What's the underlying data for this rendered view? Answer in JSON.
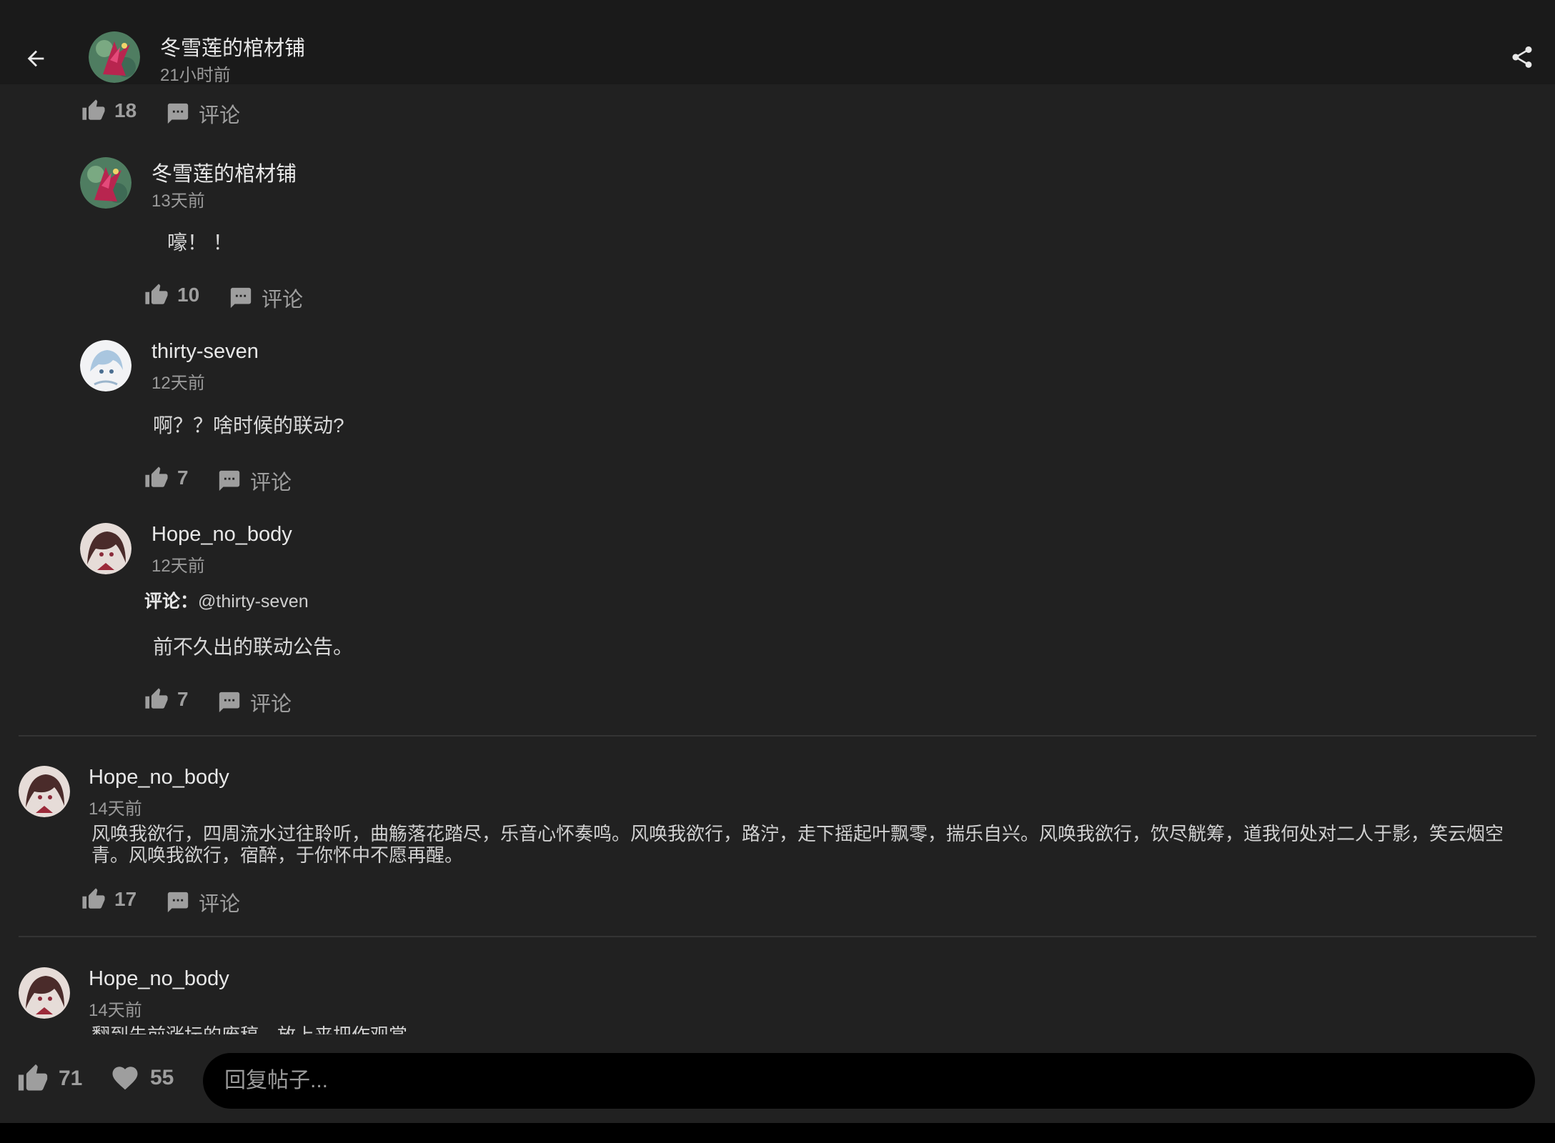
{
  "header": {
    "author": "冬雪莲的棺材铺",
    "time": "21小时前"
  },
  "post_actions": {
    "likes": "18",
    "comment_label": "评论"
  },
  "replies": [
    {
      "user": "冬雪莲的棺材铺",
      "time": "13天前",
      "text": "嚎！ ！",
      "likes": "10",
      "comment_label": "评论"
    },
    {
      "user": "thirty-seven",
      "time": "12天前",
      "text": "啊？？啥时候的联动?",
      "likes": "7",
      "comment_label": "评论"
    },
    {
      "user": "Hope_no_body",
      "time": "12天前",
      "reply_prefix": "评论：",
      "reply_to": "@thirty-seven",
      "text": "前不久出的联动公告。",
      "likes": "7",
      "comment_label": "评论"
    }
  ],
  "posts": [
    {
      "user": "Hope_no_body",
      "time": "14天前",
      "text": "风唤我欲行，四周流水过往聆听，曲觞落花踏尽，乐音心怀奏鸣。风唤我欲行，路泞，走下摇起叶飘零，揣乐自兴。风唤我欲行，饮尽觥筹，道我何处对二人于影，笑云烟空青。风唤我欲行，宿醉，于你怀中不愿再醒。",
      "likes": "17",
      "comment_label": "评论"
    },
    {
      "user": "Hope_no_body",
      "time": "14天前",
      "text": "翻到先前涨坛的废稿，放上来把作观赏"
    }
  ],
  "bottom": {
    "likes": "71",
    "favorites": "55",
    "reply_placeholder": "回复帖子..."
  },
  "icons": {
    "back": "arrow-left-icon",
    "share": "share-icon",
    "like": "thumb-up-icon",
    "comment": "comment-bubble-icon",
    "favorite": "heart-icon"
  },
  "colors": {
    "background": "#212121",
    "topbar": "#1a1a1a",
    "input": "#000000",
    "muted": "#9e9e9e"
  }
}
